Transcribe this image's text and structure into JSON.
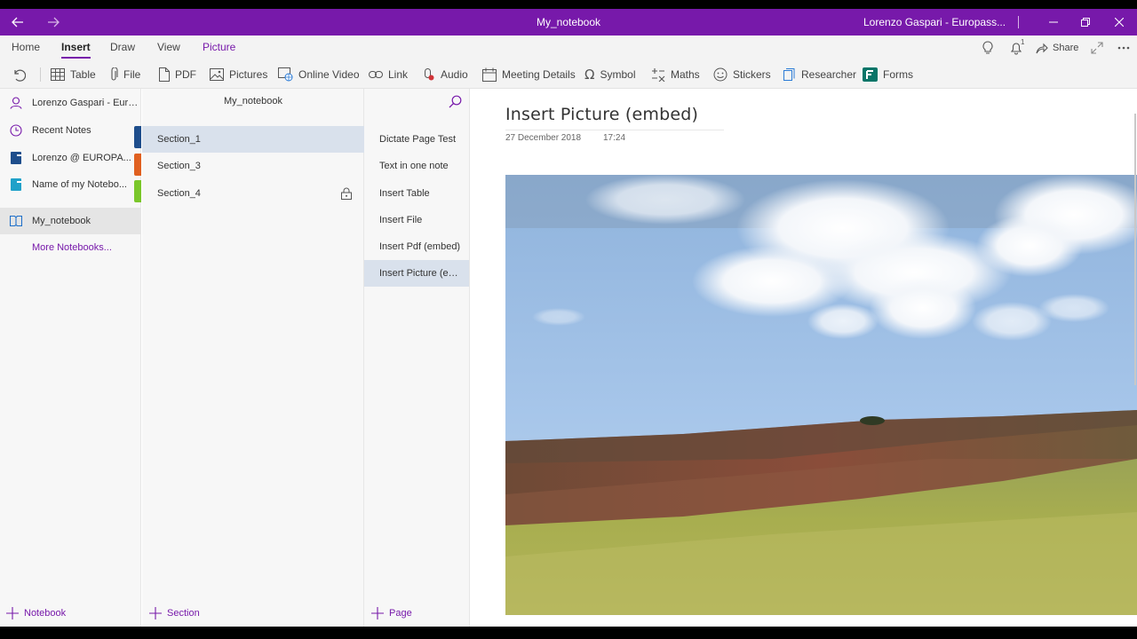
{
  "window": {
    "title": "My_notebook",
    "user": "Lorenzo Gaspari - Europass...",
    "controls": {
      "minimize": "minimize",
      "maximize": "maximize",
      "close": "close"
    }
  },
  "ribbon": {
    "tabs": [
      {
        "label": "Home"
      },
      {
        "label": "Insert"
      },
      {
        "label": "Draw"
      },
      {
        "label": "View"
      },
      {
        "label": "Picture"
      }
    ],
    "share_label": "Share",
    "notification_count": "1",
    "tools": {
      "table": "Table",
      "file": "File",
      "pdf": "PDF",
      "pictures": "Pictures",
      "online_video": "Online Video",
      "link": "Link",
      "audio": "Audio",
      "meeting_details": "Meeting Details",
      "symbol": "Symbol",
      "maths": "Maths",
      "stickers": "Stickers",
      "researcher": "Researcher",
      "forms": "Forms"
    }
  },
  "notebooks": {
    "account": "Lorenzo Gaspari - Euro...",
    "recent": "Recent Notes",
    "items": [
      {
        "label": "Lorenzo @ EUROPA...",
        "color": "#1e4e8c"
      },
      {
        "label": "Name of my Notebo...",
        "color": "#20a1c9"
      },
      {
        "label": "My_notebook",
        "color": "#1e6fc9"
      }
    ],
    "more": "More Notebooks...",
    "add_label": "Notebook"
  },
  "sections": {
    "header": "My_notebook",
    "items": [
      {
        "label": "Section_1",
        "color": "#1e4e8c"
      },
      {
        "label": "Section_3",
        "color": "#e06020"
      },
      {
        "label": "Section_4",
        "color": "#7ac72a"
      }
    ],
    "add_label": "Section"
  },
  "pages": {
    "items": [
      {
        "label": "Dictate Page Test"
      },
      {
        "label": "Text in one note"
      },
      {
        "label": "Insert Table"
      },
      {
        "label": "Insert File"
      },
      {
        "label": "Insert Pdf (embed)"
      },
      {
        "label": "Insert Picture (embed)"
      }
    ],
    "add_label": "Page"
  },
  "page": {
    "title": "Insert Picture (embed)",
    "date": "27 December 2018",
    "time": "17:24"
  },
  "colors": {
    "accent": "#7719aa"
  }
}
